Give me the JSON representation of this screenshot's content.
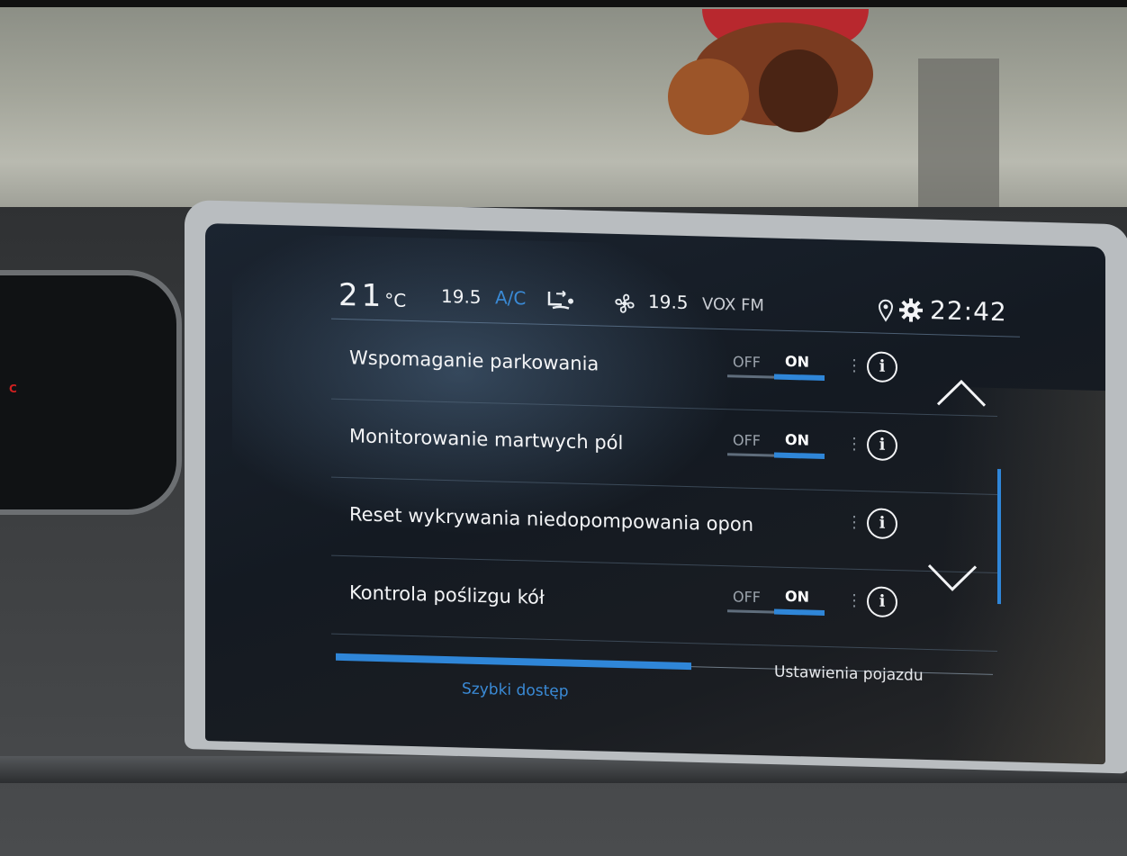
{
  "status": {
    "temp_left": "21",
    "temp_unit": "°C",
    "fan_left": "19.5",
    "ac_label": "A/C",
    "temp_right": "19.5",
    "radio": "VOX FM",
    "clock": "22:42"
  },
  "icons": {
    "seat": "seat-airflow-icon",
    "fan": "fan-icon",
    "location": "location-pin-icon",
    "settings": "gear-icon",
    "info": "info-icon",
    "scroll_up": "chevron-up-icon",
    "scroll_down": "chevron-down-icon"
  },
  "settings_list": [
    {
      "label": "Wspomaganie parkowania",
      "toggle": {
        "off": "OFF",
        "on": "ON",
        "state": "ON"
      },
      "info": "i"
    },
    {
      "label": "Monitorowanie martwych pól",
      "toggle": {
        "off": "OFF",
        "on": "ON",
        "state": "ON"
      },
      "info": "i"
    },
    {
      "label": "Reset wykrywania niedopompowania opon",
      "info": "i"
    },
    {
      "label": "Kontrola poślizgu kół",
      "toggle": {
        "off": "OFF",
        "on": "ON",
        "state": "ON"
      },
      "info": "i"
    }
  ],
  "tabs": [
    {
      "label": "Szybki dostęp",
      "active": true
    },
    {
      "label": "Ustawienia pojazdu",
      "active": false
    }
  ],
  "colors": {
    "accent": "#2f86d8",
    "text": "#f3f4f6",
    "screen_bg": "#151b23"
  }
}
